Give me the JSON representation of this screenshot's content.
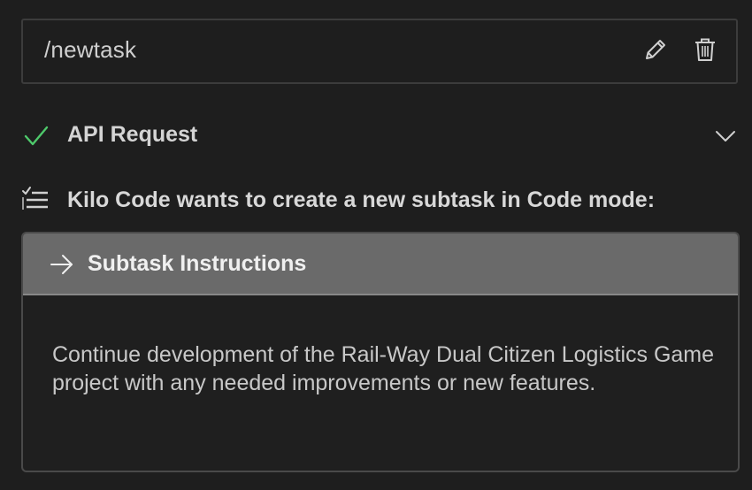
{
  "command": {
    "text": "/newtask",
    "edit_icon": "pencil-icon",
    "delete_icon": "trash-icon"
  },
  "api_request": {
    "status_icon": "checkmark-icon",
    "label": "API Request",
    "toggle_icon": "chevron-down-icon",
    "status_color": "#4ec96b"
  },
  "subtask": {
    "icon": "checklist-icon",
    "heading": "Kilo Code wants to create a new subtask in Code mode:",
    "card": {
      "icon": "arrow-right-icon",
      "title": "Subtask Instructions",
      "body": "Continue development of the Rail-Way Dual Citizen Logistics Game project with any needed improvements or new features."
    }
  },
  "colors": {
    "background": "#1e1e1e",
    "card_header": "#6a6a6a",
    "border": "#3c3c3c"
  }
}
